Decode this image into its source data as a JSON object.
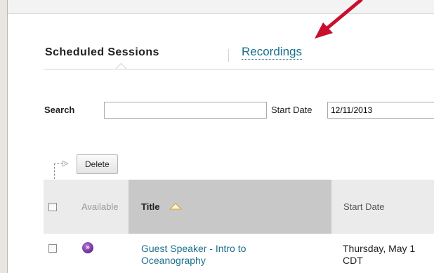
{
  "tabs": {
    "active_label": "Scheduled Sessions",
    "link_label": "Recordings"
  },
  "search": {
    "label": "Search",
    "value": "",
    "start_date_label": "Start Date",
    "start_date_value": "12/11/2013"
  },
  "toolbar": {
    "delete_label": "Delete"
  },
  "table": {
    "headers": {
      "available": "Available",
      "title": "Title",
      "start_date": "Start Date"
    },
    "rows": [
      {
        "title_line1": "Guest Speaker - Intro to",
        "title_line2": "Oceanography",
        "start_line1": "Thursday, May 1",
        "start_line2": "CDT"
      }
    ]
  },
  "colors": {
    "link": "#1a6f8c",
    "arrow": "#c8102e",
    "available_icon": "#6a2b93"
  },
  "icons": {
    "annotation": "red-arrow-icon",
    "sort": "sort-ascending-icon",
    "available": "available-icon"
  }
}
